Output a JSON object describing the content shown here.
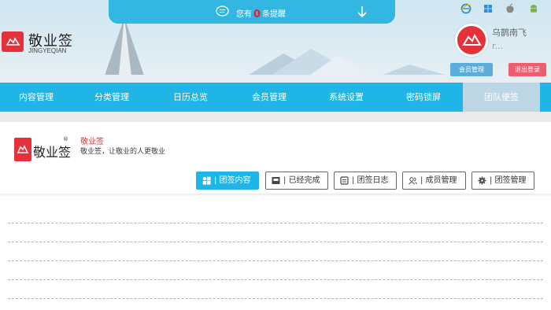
{
  "notification": {
    "prefix": "您有",
    "count": "0",
    "suffix": "条提醒"
  },
  "brand": {
    "name": "敬业签",
    "pinyin": "JINGYEQIAN"
  },
  "os_icons": [
    "ie-icon",
    "windows-icon",
    "apple-icon",
    "android-icon"
  ],
  "user": {
    "name": "乌鹊南飞",
    "sub": "r..."
  },
  "buttons": {
    "member_manage": "会员管理",
    "logout": "退出登录"
  },
  "nav": {
    "items": [
      {
        "label": "内容管理"
      },
      {
        "label": "分类管理"
      },
      {
        "label": "日历总览"
      },
      {
        "label": "会员管理"
      },
      {
        "label": "系统设置"
      },
      {
        "label": "密码锁屏"
      },
      {
        "label": "团队便签"
      }
    ],
    "active_index": 6
  },
  "team_card": {
    "logo_text": "敬业签",
    "registered": "®",
    "title": "敬业签",
    "subtitle": "敬业签，让敬业的人更敬业"
  },
  "team_tabs": [
    {
      "label": "| 团签内容",
      "icon": "grid-icon"
    },
    {
      "label": "| 已经完成",
      "icon": "inbox-icon"
    },
    {
      "label": "| 团签日志",
      "icon": "log-icon"
    },
    {
      "label": "| 成员管理",
      "icon": "users-icon"
    },
    {
      "label": "| 团签管理",
      "icon": "gear-icon"
    }
  ],
  "colors": {
    "accent": "#1fb5e6",
    "brand_red": "#e5323a",
    "logout": "#ee5d6c",
    "member_btn": "#5aaedc"
  }
}
